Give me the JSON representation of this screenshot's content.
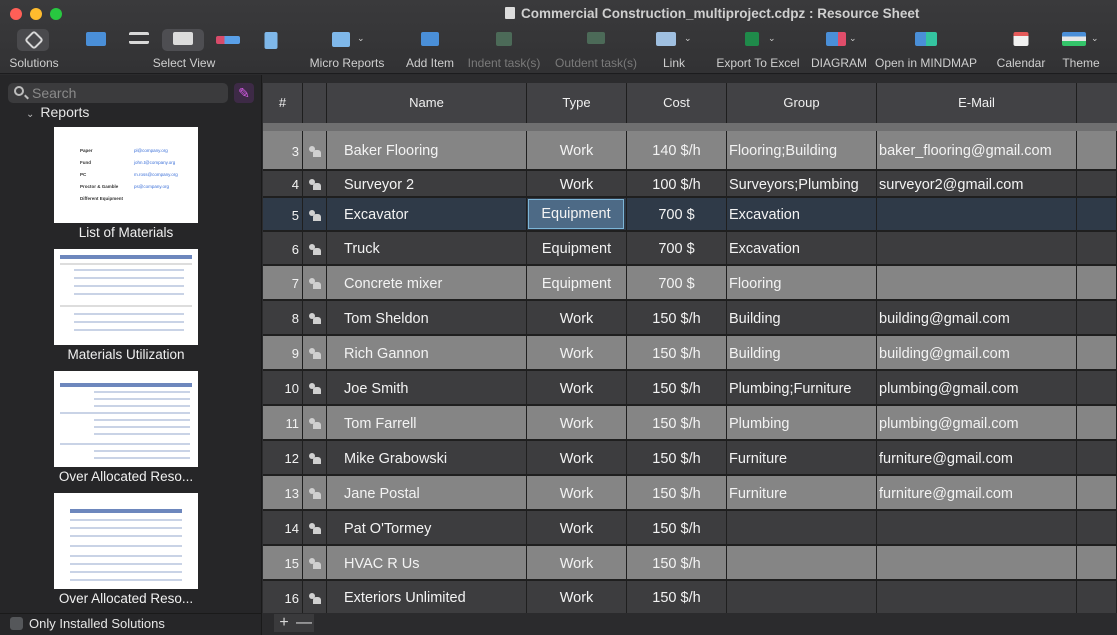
{
  "window": {
    "title": "Commercial Construction_multiproject.cdpz : Resource Sheet"
  },
  "toolbar": {
    "solutions_label": "Solutions",
    "select_view_label": "Select View",
    "micro_reports_label": "Micro Reports",
    "add_item_label": "Add Item",
    "indent_label": "Indent task(s)",
    "outdent_label": "Outdent task(s)",
    "link_label": "Link",
    "export_excel_label": "Export To Excel",
    "diagram_label": "DIAGRAM",
    "mindmap_label": "Open in MINDMAP",
    "calendar_label": "Calendar",
    "theme_label": "Theme"
  },
  "sidebar": {
    "search_placeholder": "Search",
    "section_title": "Reports",
    "reports": [
      {
        "label": "List of Materials"
      },
      {
        "label": "Materials Utilization"
      },
      {
        "label": "Over Allocated Reso..."
      },
      {
        "label": "Over Allocated Reso..."
      }
    ],
    "thumb_text": {
      "paper": "Paper",
      "fund": "Fund",
      "pc": "PC",
      "proctor": "Proctor & Gamble",
      "different": "Different Equipment",
      "link1": "pl@company.org",
      "link2": "john.t@company.org",
      "link3": "m.ross@company.org",
      "link4": "ps@company.org"
    },
    "only_installed_label": "Only Installed Solutions"
  },
  "grid": {
    "columns": [
      "#",
      "",
      "Name",
      "Type",
      "Cost",
      "Group",
      "E-Mail"
    ],
    "rows": [
      {
        "num": "3",
        "name": "Baker Flooring",
        "type": "Work",
        "cost": "140 $/h",
        "group": "Flooring;Building",
        "email": "baker_flooring@gmail.com"
      },
      {
        "num": "4",
        "name": "Surveyor 2",
        "type": "Work",
        "cost": "100 $/h",
        "group": "Surveyors;Plumbing",
        "email": "surveyor2@gmail.com"
      },
      {
        "num": "5",
        "name": "Excavator",
        "type": "Equipment",
        "cost": "700 $",
        "group": "Excavation",
        "email": ""
      },
      {
        "num": "6",
        "name": "Truck",
        "type": "Equipment",
        "cost": "700 $",
        "group": "Excavation",
        "email": ""
      },
      {
        "num": "7",
        "name": "Concrete mixer",
        "type": "Equipment",
        "cost": "700 $",
        "group": "Flooring",
        "email": ""
      },
      {
        "num": "8",
        "name": "Tom Sheldon",
        "type": "Work",
        "cost": "150 $/h",
        "group": "Building",
        "email": "building@gmail.com"
      },
      {
        "num": "9",
        "name": "Rich Gannon",
        "type": "Work",
        "cost": "150 $/h",
        "group": "Building",
        "email": "building@gmail.com"
      },
      {
        "num": "10",
        "name": "Joe Smith",
        "type": "Work",
        "cost": "150 $/h",
        "group": "Plumbing;Furniture",
        "email": "plumbing@gmail.com"
      },
      {
        "num": "11",
        "name": "Tom Farrell",
        "type": "Work",
        "cost": "150 $/h",
        "group": "Plumbing",
        "email": "plumbing@gmail.com"
      },
      {
        "num": "12",
        "name": "Mike Grabowski",
        "type": "Work",
        "cost": "150 $/h",
        "group": "Furniture",
        "email": "furniture@gmail.com"
      },
      {
        "num": "13",
        "name": "Jane Postal",
        "type": "Work",
        "cost": "150 $/h",
        "group": "Furniture",
        "email": "furniture@gmail.com"
      },
      {
        "num": "14",
        "name": "Pat O'Tormey",
        "type": "Work",
        "cost": "150 $/h",
        "group": "",
        "email": ""
      },
      {
        "num": "15",
        "name": "HVAC R Us",
        "type": "Work",
        "cost": "150 $/h",
        "group": "",
        "email": ""
      },
      {
        "num": "16",
        "name": "Exteriors Unlimited",
        "type": "Work",
        "cost": "150 $/h",
        "group": "",
        "email": ""
      }
    ],
    "selected_row_num": "5",
    "add_row_label": "+",
    "remove_row_label": "—"
  },
  "colors": {
    "row_light": "#858585",
    "row_dark": "#3d3d3f",
    "row_selected": "#2f3a48",
    "accent_purple": "#d85de8"
  }
}
